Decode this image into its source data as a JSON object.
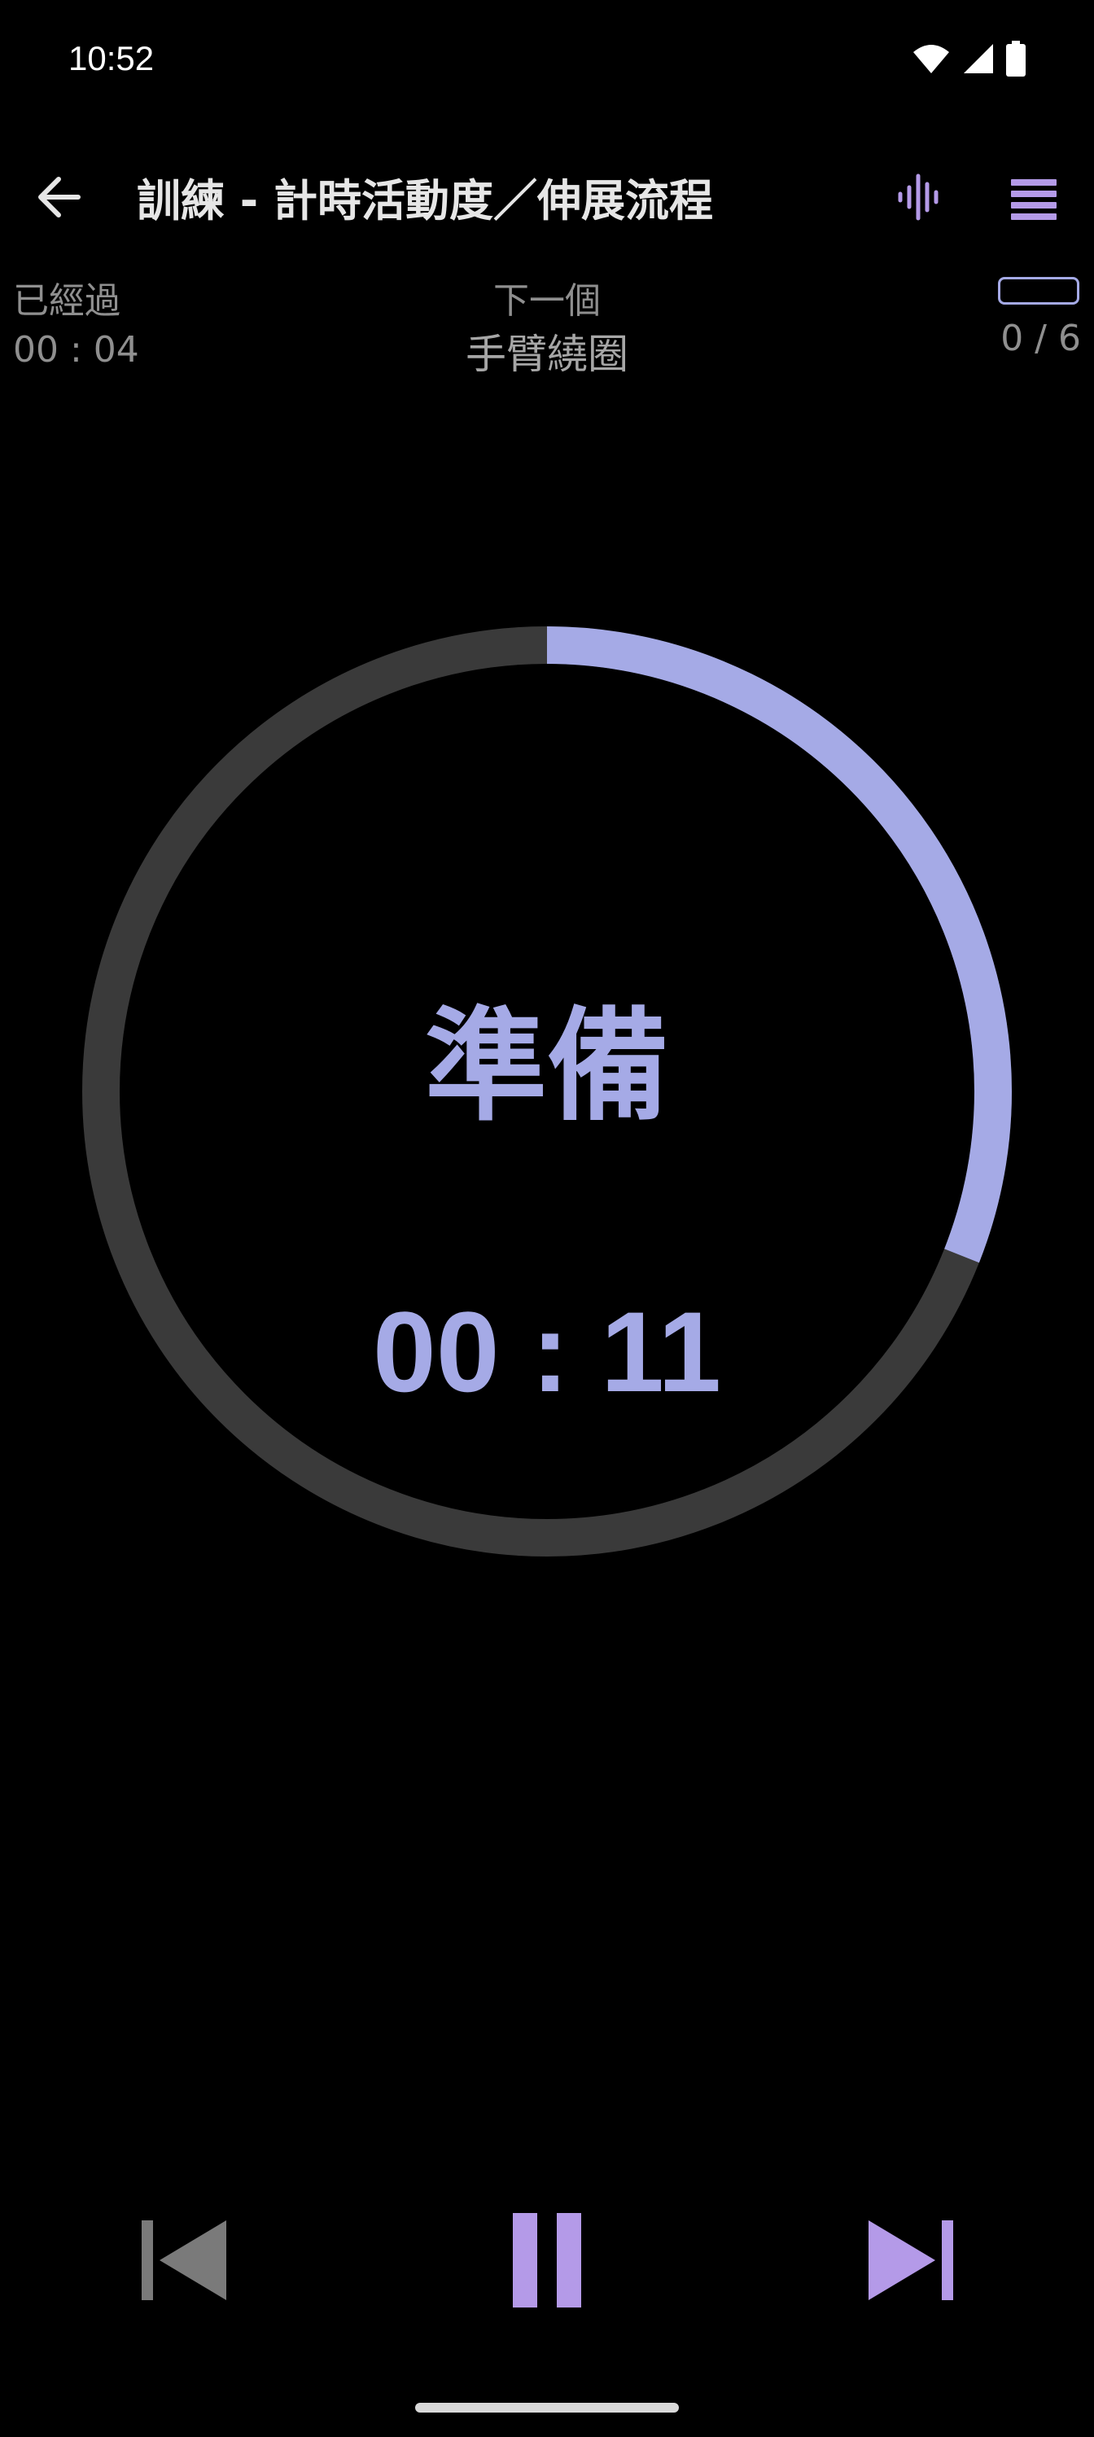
{
  "status_bar": {
    "time": "10:52"
  },
  "app_bar": {
    "title": "訓練 - 計時活動度／伸展流程",
    "accent": "#b49ae8"
  },
  "info": {
    "elapsed_label": "已經過",
    "elapsed_value": "00 : 04",
    "next_label": "下一個",
    "next_value": "手臂繞圈",
    "counter": "0 / 6"
  },
  "timer": {
    "phase": "準備",
    "remaining": "00 : 11",
    "progress_fraction": 0.31,
    "progress_color": "#a5aae6",
    "track_color": "#3a3a3a"
  },
  "controls": {
    "prev_icon": "skip-previous-icon",
    "pause_icon": "pause-icon",
    "next_icon": "skip-next-icon"
  }
}
